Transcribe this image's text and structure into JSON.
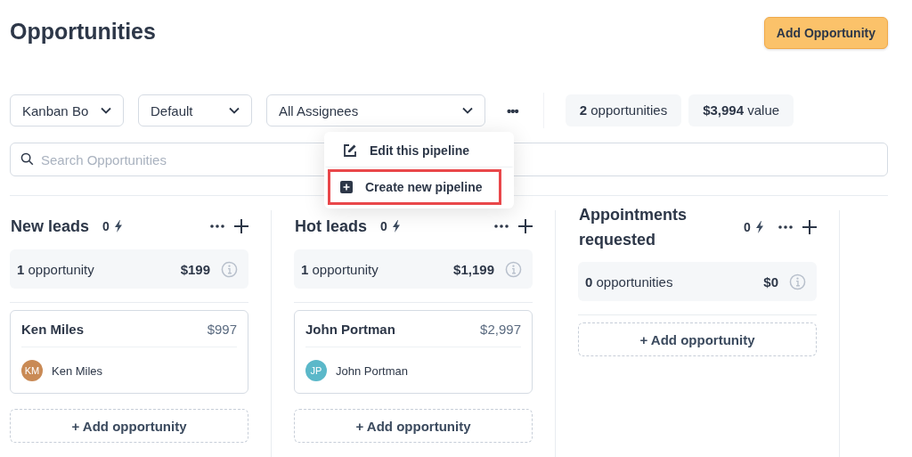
{
  "header": {
    "title": "Opportunities",
    "add_button": "Add Opportunity"
  },
  "filters": [
    {
      "value": "Kanban Bo",
      "kind": "dropdown"
    },
    {
      "value": "Default",
      "kind": "dropdown"
    },
    {
      "value": "All Assignees",
      "kind": "dropdown"
    }
  ],
  "more_button": "•••",
  "stats": [
    "**2** opportunities",
    "**$3,994** value"
  ],
  "search": {
    "placeholder": "Search Opportunities"
  },
  "menu": {
    "items": [
      {
        "label": "Edit this pipeline",
        "kind": "edit",
        "highlighted": false
      },
      {
        "label": "Create new pipeline",
        "kind": "create",
        "highlighted": true
      }
    ]
  },
  "columns": [
    {
      "title": "New leads",
      "count": "0",
      "summary": "**1** opportunity",
      "total": "$199",
      "cards": [
        {
          "name": "Ken Miles",
          "amount": "$997",
          "initials": "KM",
          "color": "#c98a55",
          "assignee": "Ken Miles"
        }
      ],
      "add": "+ Add opportunity"
    },
    {
      "title": "Hot leads",
      "count": "0",
      "summary": "**1** opportunity",
      "total": "$1,199",
      "cards": [
        {
          "name": "John Portman",
          "amount": "$2,997",
          "initials": "JP",
          "color": "#5bb8c9",
          "assignee": "John Portman"
        }
      ],
      "add": "+ Add opportunity"
    },
    {
      "title": "Appointments requested",
      "count": "0",
      "summary": "**0** opportunities",
      "total": "$0",
      "add": "+ Add opportunity"
    }
  ]
}
